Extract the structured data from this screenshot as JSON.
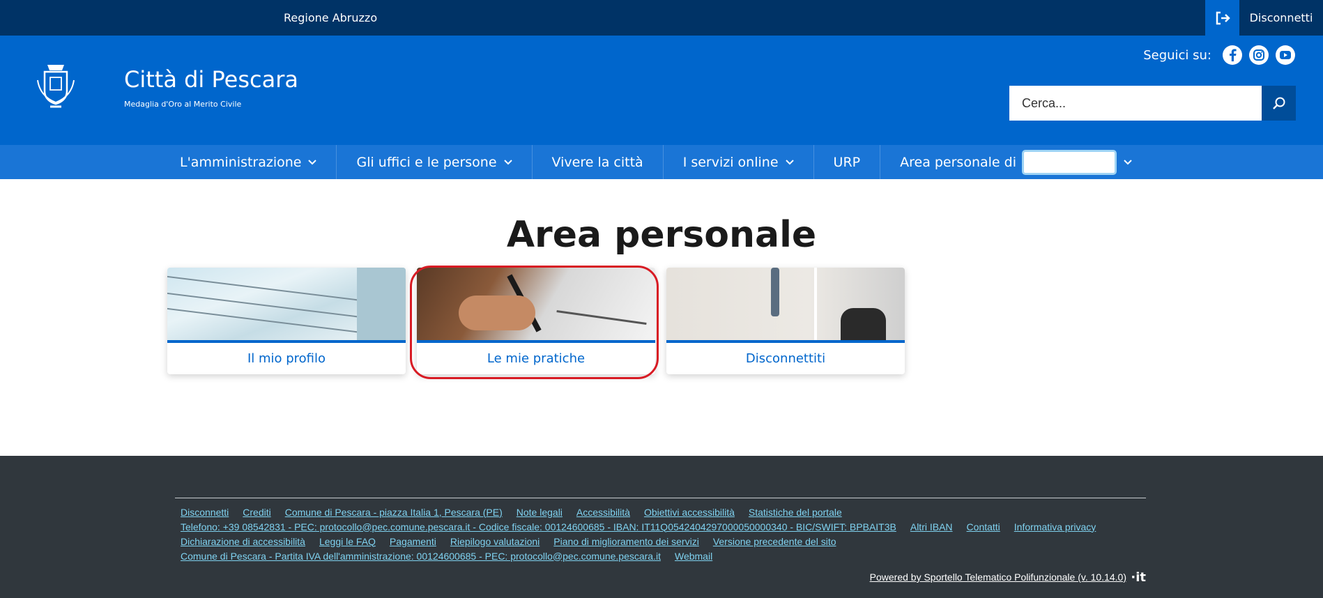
{
  "topbar": {
    "region": "Regione Abruzzo",
    "logout_label": "Disconnetti",
    "logout_icon": "sign-out-icon"
  },
  "header": {
    "title": "Città di Pescara",
    "subtitle": "Medaglia d'Oro al Merito Civile",
    "crest_icon": "city-crest-icon",
    "follow_label": "Seguici su:",
    "social": [
      "facebook-icon",
      "instagram-icon",
      "youtube-icon"
    ],
    "search_placeholder": "Cerca...",
    "search_icon": "search-icon"
  },
  "nav": {
    "items": [
      {
        "label": "L'amministrazione",
        "dropdown": true
      },
      {
        "label": "Gli uffici e le persone",
        "dropdown": true
      },
      {
        "label": "Vivere la città",
        "dropdown": false
      },
      {
        "label": "I servizi online",
        "dropdown": true
      },
      {
        "label": "URP",
        "dropdown": false
      },
      {
        "label": "Area personale di",
        "dropdown": true
      }
    ]
  },
  "main": {
    "title": "Area personale",
    "cards": [
      {
        "label": "Il mio profilo",
        "image": "identity-card-image"
      },
      {
        "label": "Le mie pratiche",
        "image": "signing-document-image"
      },
      {
        "label": "Disconnettiti",
        "image": "door-exit-image"
      }
    ]
  },
  "footer": {
    "rows": [
      [
        "Disconnetti",
        "Crediti",
        "Comune di Pescara - piazza Italia 1, Pescara (PE)",
        "Note legali",
        "Accessibilità",
        "Obiettivi accessibilità",
        "Statistiche del portale"
      ],
      [
        "Telefono: +39 08542831 - PEC: protocollo@pec.comune.pescara.it - Codice fiscale: 00124600685 - IBAN: IT11Q0542404297000050000340 - BIC/SWIFT: BPBAIT3B",
        "Altri IBAN",
        "Contatti",
        "Informativa privacy"
      ],
      [
        "Dichiarazione di accessibilità",
        "Leggi le FAQ",
        "Pagamenti",
        "Riepilogo valutazioni",
        "Piano di miglioramento dei servizi",
        "Versione precedente del sito"
      ],
      [
        "Comune di Pescara - Partita IVA dell'amministrazione: 00124600685 - PEC: protocollo@pec.comune.pescara.it",
        "Webmail"
      ]
    ],
    "powered": "Powered by Sportello Telematico Polifunzionale (v. 10.14.0)",
    "it_logo": "·it"
  },
  "colors": {
    "topbar": "#003366",
    "header": "#0066cc",
    "nav": "#1a75d6",
    "footer": "#30373d",
    "link": "#7fd2f0",
    "highlight": "#d81b24"
  }
}
